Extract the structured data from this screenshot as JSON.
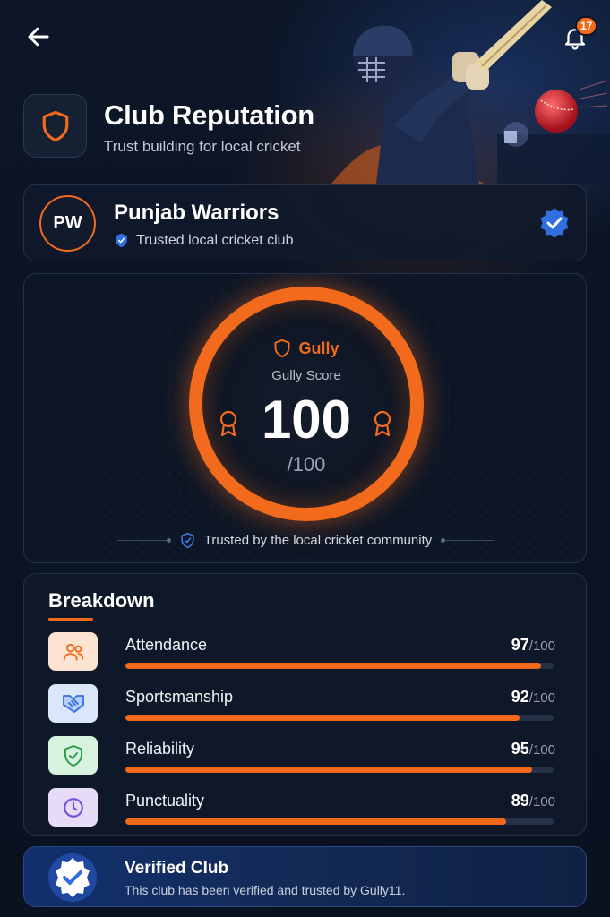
{
  "topbar": {
    "notification_count": "17"
  },
  "header": {
    "title": "Club Reputation",
    "subtitle": "Trust building for local cricket"
  },
  "club": {
    "initials": "PW",
    "name": "Punjab Warriors",
    "tag": "Trusted local cricket club"
  },
  "score": {
    "brand": "Gully",
    "label": "Gully Score",
    "value": "100",
    "max": "/100",
    "trust_text": "Trusted by the local cricket community"
  },
  "breakdown": {
    "title": "Breakdown",
    "items": [
      {
        "label": "Attendance",
        "score": "97",
        "max": "/100",
        "fraction": 0.97,
        "icon": "people-icon",
        "icon_color": "#f26a1b",
        "icon_bg": "#fde3d1"
      },
      {
        "label": "Sportsmanship",
        "score": "92",
        "max": "/100",
        "fraction": 0.92,
        "icon": "handshake-icon",
        "icon_color": "#2f6fe0",
        "icon_bg": "#dbe6fb"
      },
      {
        "label": "Reliability",
        "score": "95",
        "max": "/100",
        "fraction": 0.95,
        "icon": "shield-check-icon",
        "icon_color": "#2e9e4c",
        "icon_bg": "#d7f3de"
      },
      {
        "label": "Punctuality",
        "score": "89",
        "max": "/100",
        "fraction": 0.89,
        "icon": "clock-icon",
        "icon_color": "#7b4fd6",
        "icon_bg": "#e6dcf8"
      }
    ]
  },
  "verified": {
    "title": "Verified Club",
    "subtitle": "This club has been verified and trusted by Gully11."
  },
  "colors": {
    "accent": "#f26a1b",
    "background": "#0b1322",
    "verified_blue": "#2f6fe0"
  }
}
